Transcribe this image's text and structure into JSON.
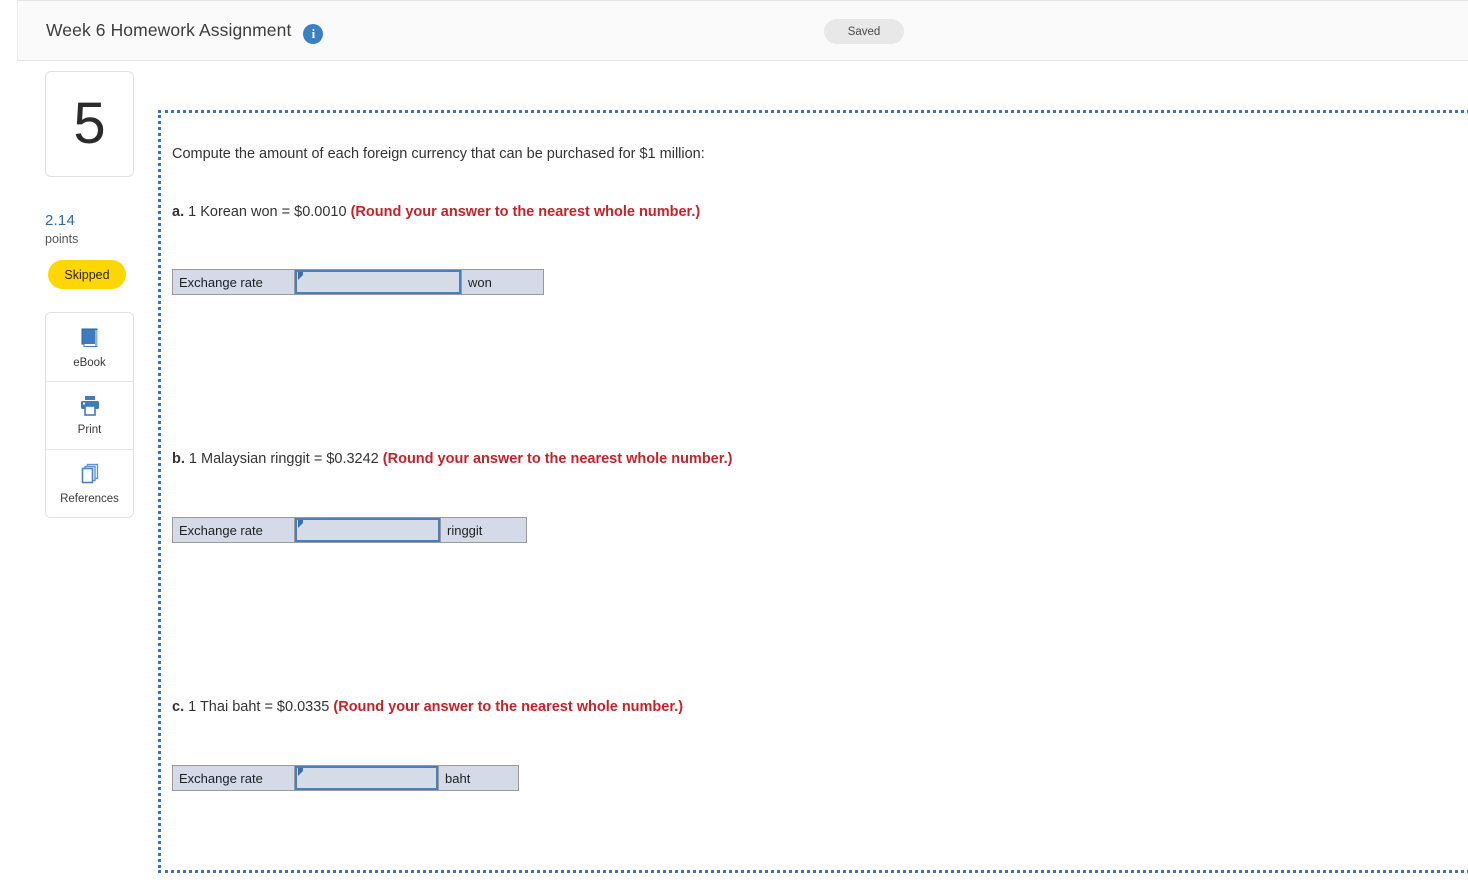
{
  "header": {
    "title": "Week 6 Homework Assignment",
    "info_icon": "info-icon",
    "status_pill": "Saved"
  },
  "sidebar": {
    "question_number": "5",
    "points_value": "2.14",
    "points_label": "points",
    "status_badge": "Skipped",
    "tools": [
      {
        "label": "eBook",
        "icon": "book-icon"
      },
      {
        "label": "Print",
        "icon": "printer-icon"
      },
      {
        "label": "References",
        "icon": "pages-stack-icon"
      }
    ]
  },
  "question": {
    "intro": "Compute the amount of each foreign currency that can be purchased for $1 million:",
    "parts": [
      {
        "letter": "a.",
        "prompt": " 1 Korean won = $0.0010 ",
        "round_note": "(Round your answer to the nearest whole number.)",
        "row_label": "Exchange rate",
        "input_value": "",
        "unit": "won"
      },
      {
        "letter": "b.",
        "prompt": " 1 Malaysian ringgit = $0.3242 ",
        "round_note": "(Round your answer to the nearest whole number.)",
        "row_label": "Exchange rate",
        "input_value": "",
        "unit": "ringgit"
      },
      {
        "letter": "c.",
        "prompt": " 1 Thai baht = $0.0335 ",
        "round_note": "(Round your answer to the nearest whole number.)",
        "row_label": "Exchange rate",
        "input_value": "",
        "unit": "baht"
      }
    ]
  },
  "colors": {
    "accent_blue": "#3874b8",
    "link_blue": "#2d6ca2",
    "warning_red": "#c7222a",
    "badge_yellow": "#FFD700",
    "field_fill": "#d4dae8"
  }
}
